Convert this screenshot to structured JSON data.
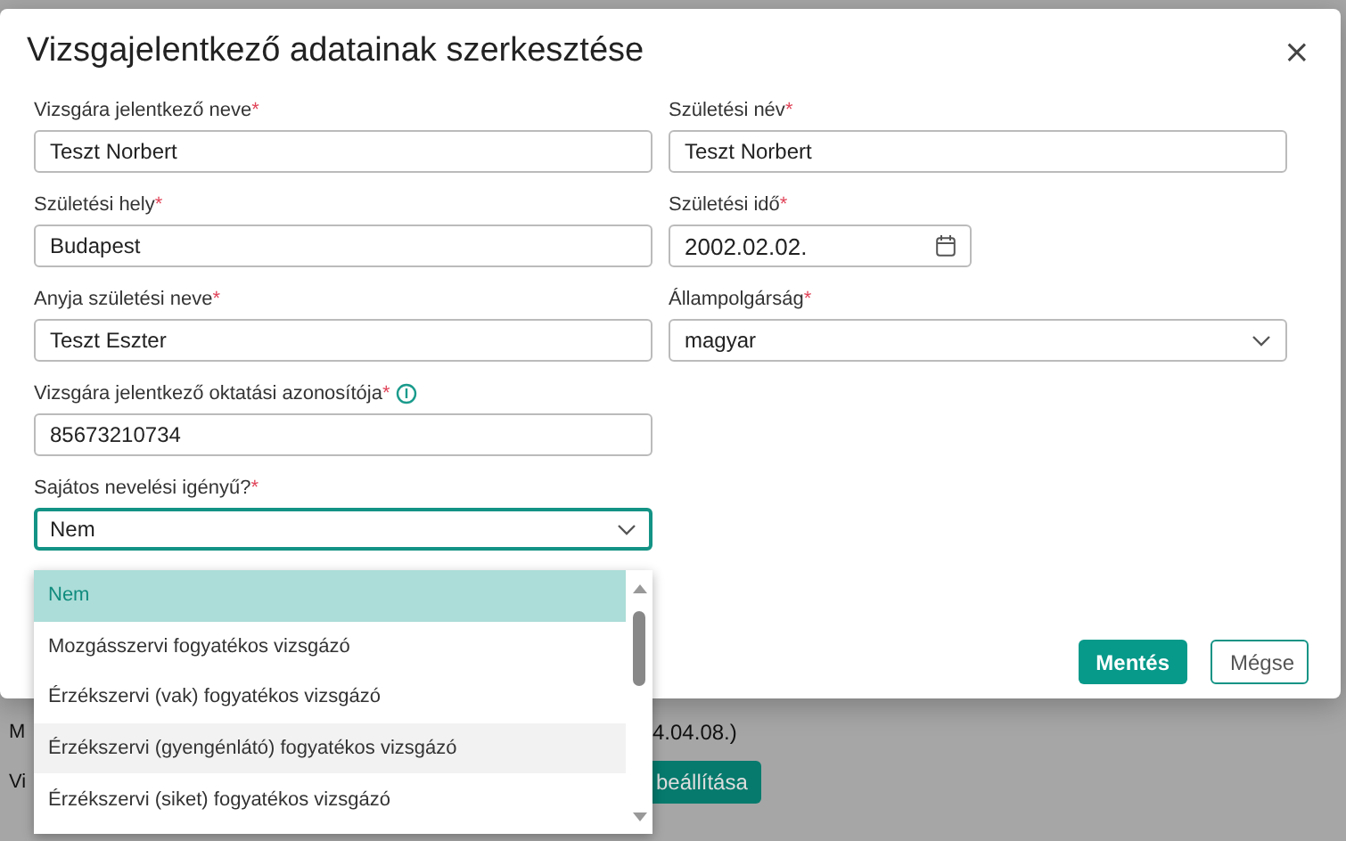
{
  "background_page": {
    "lines": [
      {
        "left": "M",
        "right": "4.04.08.)",
        "kind": "text"
      },
      {
        "left": "Vi",
        "right": "beállítása",
        "kind": "button"
      }
    ]
  },
  "dialog": {
    "title": "Vizsgajelentkező adatainak szerkesztése",
    "close": "×",
    "fields": [
      {
        "label": "Vizsgára jelentkező neve",
        "required_mark": "*",
        "value": "Teszt Norbert",
        "kind": "text"
      },
      {
        "label": "Születési név",
        "required_mark": "*",
        "value": "Teszt Norbert",
        "kind": "text"
      },
      {
        "label": "Születési hely",
        "required_mark": "*",
        "value": "Budapest",
        "kind": "text"
      },
      {
        "label": "Születési idő",
        "required_mark": "*",
        "value": "2002.02.02.",
        "kind": "date"
      },
      {
        "label": "Anyja születési neve",
        "required_mark": "*",
        "value": "Teszt Eszter",
        "kind": "text"
      },
      {
        "label": "Állampolgárság",
        "required_mark": "*",
        "value": "magyar",
        "kind": "select"
      },
      {
        "label": "Vizsgára jelentkező oktatási azonosítója",
        "required_mark": "*",
        "value": "85673210734",
        "kind": "text",
        "info": true
      },
      {
        "label": "Sajátos nevelési igényű?",
        "required_mark": "*",
        "value": "Nem",
        "kind": "select",
        "expanded": true
      }
    ],
    "dropdown_options": [
      {
        "label": "Nem",
        "selected": true,
        "hovered": false
      },
      {
        "label": "Mozgásszervi fogyatékos vizsgázó",
        "selected": false,
        "hovered": false
      },
      {
        "label": "Érzékszervi (vak) fogyatékos vizsgázó",
        "selected": false,
        "hovered": false
      },
      {
        "label": "Érzékszervi (gyengénlátó) fogyatékos vizsgázó",
        "selected": false,
        "hovered": true
      },
      {
        "label": "Érzékszervi (siket) fogyatékos vizsgázó",
        "selected": false,
        "hovered": false
      }
    ],
    "buttons": [
      {
        "label": "Mentés",
        "kind": "primary"
      },
      {
        "label": "Mégse",
        "kind": "secondary"
      }
    ]
  }
}
